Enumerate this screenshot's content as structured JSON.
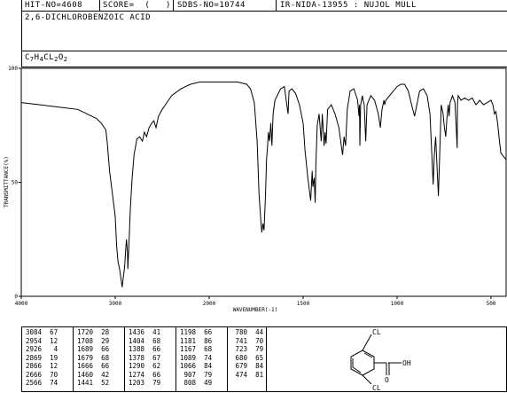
{
  "header": {
    "hit_no": "HIT-NO=4608",
    "score": "SCORE=  (   )",
    "sdbs_no": "SDBS-NO=10744",
    "ir_code": "IR-NIDA-13955 : NUJOL MULL",
    "compound_name": "2,6-DICHLOROBENZOIC ACID",
    "formula_parts": [
      {
        "t": "C",
        "sub": false
      },
      {
        "t": "7",
        "sub": true
      },
      {
        "t": "H",
        "sub": false
      },
      {
        "t": "4",
        "sub": true
      },
      {
        "t": "CL",
        "sub": false
      },
      {
        "t": "2",
        "sub": true
      },
      {
        "t": "O",
        "sub": false
      },
      {
        "t": "2",
        "sub": true
      }
    ]
  },
  "chart_data": {
    "type": "line",
    "xlabel": "WAVENUMBER(-1)",
    "ylabel": "TRANSMITTANCE(%)",
    "xlim": [
      4000,
      600
    ],
    "ylim": [
      0,
      100
    ],
    "x_tick_labels": [
      "4000",
      "3000",
      "2000",
      "1500",
      "1000",
      "500"
    ],
    "y_tick_labels": [
      "100",
      "50",
      "0"
    ],
    "peaks": [
      {
        "x": 3084,
        "y": 67
      },
      {
        "x": 2954,
        "y": 12
      },
      {
        "x": 2926,
        "y": 4
      },
      {
        "x": 2869,
        "y": 19
      },
      {
        "x": 2866,
        "y": 12
      },
      {
        "x": 2666,
        "y": 70
      },
      {
        "x": 2566,
        "y": 74
      },
      {
        "x": 1720,
        "y": 28
      },
      {
        "x": 1708,
        "y": 29
      },
      {
        "x": 1689,
        "y": 66
      },
      {
        "x": 1679,
        "y": 68
      },
      {
        "x": 1666,
        "y": 66
      },
      {
        "x": 1460,
        "y": 42
      },
      {
        "x": 1441,
        "y": 52
      },
      {
        "x": 1436,
        "y": 41
      },
      {
        "x": 1404,
        "y": 68
      },
      {
        "x": 1388,
        "y": 66
      },
      {
        "x": 1378,
        "y": 67
      },
      {
        "x": 1290,
        "y": 62
      },
      {
        "x": 1274,
        "y": 66
      },
      {
        "x": 1203,
        "y": 79
      },
      {
        "x": 1198,
        "y": 66
      },
      {
        "x": 1181,
        "y": 86
      },
      {
        "x": 1167,
        "y": 68
      },
      {
        "x": 1089,
        "y": 74
      },
      {
        "x": 1066,
        "y": 84
      },
      {
        "x": 907,
        "y": 79
      },
      {
        "x": 808,
        "y": 49
      },
      {
        "x": 780,
        "y": 44
      },
      {
        "x": 741,
        "y": 70
      },
      {
        "x": 723,
        "y": 79
      },
      {
        "x": 680,
        "y": 65
      },
      {
        "x": 679,
        "y": 84
      },
      {
        "x": 474,
        "y": 81
      }
    ],
    "curve": [
      [
        4000,
        85
      ],
      [
        3800,
        84
      ],
      [
        3600,
        83
      ],
      [
        3400,
        82
      ],
      [
        3300,
        80
      ],
      [
        3200,
        78
      ],
      [
        3150,
        76
      ],
      [
        3100,
        73
      ],
      [
        3084,
        67
      ],
      [
        3060,
        55
      ],
      [
        3030,
        45
      ],
      [
        3000,
        35
      ],
      [
        2985,
        22
      ],
      [
        2970,
        15
      ],
      [
        2954,
        12
      ],
      [
        2940,
        8
      ],
      [
        2926,
        4
      ],
      [
        2915,
        8
      ],
      [
        2900,
        13
      ],
      [
        2890,
        20
      ],
      [
        2880,
        25
      ],
      [
        2869,
        19
      ],
      [
        2866,
        12
      ],
      [
        2855,
        22
      ],
      [
        2840,
        38
      ],
      [
        2820,
        52
      ],
      [
        2800,
        62
      ],
      [
        2770,
        69
      ],
      [
        2740,
        70
      ],
      [
        2710,
        68
      ],
      [
        2690,
        72
      ],
      [
        2666,
        70
      ],
      [
        2640,
        74
      ],
      [
        2610,
        76
      ],
      [
        2590,
        77
      ],
      [
        2566,
        74
      ],
      [
        2540,
        79
      ],
      [
        2500,
        82
      ],
      [
        2450,
        85
      ],
      [
        2400,
        88
      ],
      [
        2300,
        91
      ],
      [
        2200,
        93
      ],
      [
        2100,
        94
      ],
      [
        2000,
        94
      ],
      [
        1950,
        94
      ],
      [
        1900,
        94
      ],
      [
        1850,
        94
      ],
      [
        1800,
        93
      ],
      [
        1780,
        91
      ],
      [
        1760,
        85
      ],
      [
        1745,
        68
      ],
      [
        1735,
        45
      ],
      [
        1725,
        33
      ],
      [
        1720,
        28
      ],
      [
        1714,
        32
      ],
      [
        1708,
        29
      ],
      [
        1700,
        45
      ],
      [
        1695,
        60
      ],
      [
        1689,
        66
      ],
      [
        1685,
        72
      ],
      [
        1679,
        68
      ],
      [
        1672,
        76
      ],
      [
        1666,
        66
      ],
      [
        1660,
        80
      ],
      [
        1650,
        86
      ],
      [
        1620,
        91
      ],
      [
        1600,
        92
      ],
      [
        1580,
        80
      ],
      [
        1575,
        90
      ],
      [
        1560,
        91
      ],
      [
        1540,
        89
      ],
      [
        1520,
        84
      ],
      [
        1500,
        76
      ],
      [
        1490,
        64
      ],
      [
        1475,
        52
      ],
      [
        1460,
        42
      ],
      [
        1452,
        55
      ],
      [
        1448,
        48
      ],
      [
        1441,
        52
      ],
      [
        1436,
        41
      ],
      [
        1432,
        58
      ],
      [
        1425,
        75
      ],
      [
        1415,
        80
      ],
      [
        1404,
        68
      ],
      [
        1398,
        80
      ],
      [
        1388,
        66
      ],
      [
        1383,
        72
      ],
      [
        1378,
        67
      ],
      [
        1370,
        82
      ],
      [
        1350,
        84
      ],
      [
        1330,
        80
      ],
      [
        1310,
        74
      ],
      [
        1300,
        68
      ],
      [
        1290,
        62
      ],
      [
        1282,
        70
      ],
      [
        1274,
        66
      ],
      [
        1265,
        82
      ],
      [
        1250,
        90
      ],
      [
        1230,
        91
      ],
      [
        1210,
        86
      ],
      [
        1203,
        79
      ],
      [
        1200,
        84
      ],
      [
        1198,
        66
      ],
      [
        1194,
        84
      ],
      [
        1185,
        88
      ],
      [
        1181,
        86
      ],
      [
        1175,
        84
      ],
      [
        1167,
        68
      ],
      [
        1160,
        84
      ],
      [
        1140,
        88
      ],
      [
        1120,
        86
      ],
      [
        1100,
        80
      ],
      [
        1089,
        74
      ],
      [
        1080,
        82
      ],
      [
        1070,
        86
      ],
      [
        1066,
        84
      ],
      [
        1060,
        86
      ],
      [
        1040,
        88
      ],
      [
        1020,
        90
      ],
      [
        1000,
        92
      ],
      [
        980,
        93
      ],
      [
        960,
        93
      ],
      [
        940,
        90
      ],
      [
        920,
        83
      ],
      [
        907,
        79
      ],
      [
        895,
        84
      ],
      [
        880,
        90
      ],
      [
        860,
        91
      ],
      [
        840,
        88
      ],
      [
        825,
        80
      ],
      [
        815,
        62
      ],
      [
        808,
        49
      ],
      [
        802,
        62
      ],
      [
        795,
        70
      ],
      [
        788,
        58
      ],
      [
        780,
        44
      ],
      [
        774,
        60
      ],
      [
        765,
        84
      ],
      [
        755,
        80
      ],
      [
        748,
        74
      ],
      [
        741,
        70
      ],
      [
        735,
        78
      ],
      [
        728,
        84
      ],
      [
        723,
        79
      ],
      [
        718,
        85
      ],
      [
        705,
        88
      ],
      [
        692,
        85
      ],
      [
        686,
        75
      ],
      [
        680,
        65
      ],
      [
        679,
        84
      ],
      [
        675,
        88
      ],
      [
        660,
        86
      ],
      [
        640,
        87
      ],
      [
        620,
        86
      ],
      [
        600,
        87
      ],
      [
        580,
        84
      ],
      [
        560,
        86
      ],
      [
        540,
        84
      ],
      [
        520,
        85
      ],
      [
        500,
        86
      ],
      [
        490,
        84
      ],
      [
        482,
        80
      ],
      [
        474,
        81
      ],
      [
        465,
        76
      ],
      [
        455,
        68
      ],
      [
        448,
        63
      ],
      [
        440,
        62
      ],
      [
        430,
        61
      ],
      [
        420,
        60
      ]
    ]
  },
  "structure_labels": {
    "top_substituent": "CL",
    "bottom_substituent": "CL",
    "carbonyl_o": "O",
    "hydroxyl": "OH"
  }
}
